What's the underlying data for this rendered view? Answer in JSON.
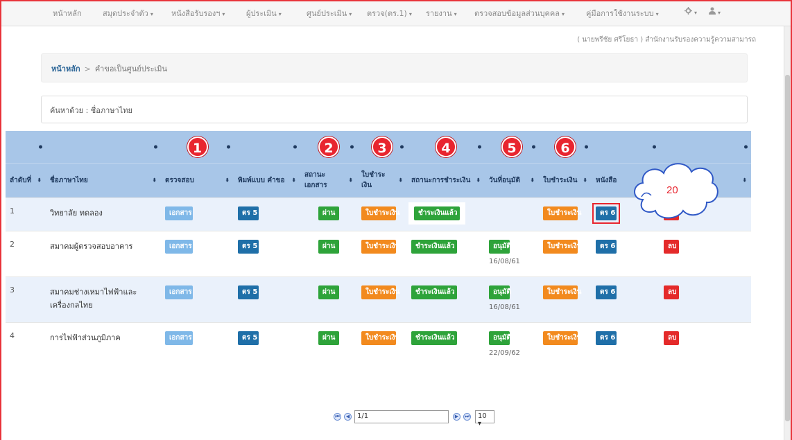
{
  "nav": {
    "items": [
      "หน้าหลัก",
      "สมุดประจำตัว",
      "หนังสือรับรองฯ",
      "ผู้ประเมิน",
      "ศูนย์ประเมิน",
      "ตรวจ(ตร.1)",
      "รายงาน",
      "ตรวจสอบข้อมูลส่วนบุคคล",
      "คู่มือการใช้งานระบบ"
    ],
    "caret": "▾",
    "settings_icon": "gear-icon",
    "user_icon": "user-icon"
  },
  "user_line": "( นายพรีชัย ศรีโยธา ) สำนักงานรับรองความรู้ความสามารถ",
  "breadcrumb": {
    "home": "หน้าหลัก",
    "separator": ">",
    "current": "คำขอเป็นศูนย์ประเมิน"
  },
  "search": {
    "label": "ค้นหาด้วย : ชื่อภาษาไทย"
  },
  "steps": [
    "1",
    "2",
    "3",
    "4",
    "5",
    "6"
  ],
  "headers": [
    "ลำดับที่",
    "ชื่อภาษาไทย",
    "ตรวจสอบ",
    "พิมพ์แบบ คำขอ",
    "สถานะเอกสาร",
    "ใบชำระเงิน",
    "สถานะการชำระเงิน",
    "วันที่อนุมัติ",
    "ใบชำระเงิน",
    "หนังสือ",
    ""
  ],
  "sort_symbol": "⬍",
  "buttons": {
    "doc": "เอกสาร",
    "form": "ตร 5",
    "pass": "ผ่าน",
    "invoice": "ใบชำระเงิน",
    "paid": "ชำระเงินแล้ว",
    "approve": "อนุมัติ",
    "cert": "ตร 6",
    "delete": "ลบ"
  },
  "rows": [
    {
      "no": "1",
      "name": "วิทยาลัย ทดลอง",
      "approve_date": ""
    },
    {
      "no": "2",
      "name": "สมาคมผู้ตรวจสอบอาคาร",
      "approve_date": "16/08/61"
    },
    {
      "no": "3",
      "name": "สมาคมช่างเหมาไฟฟ้าและเครื่องกลไทย",
      "approve_date": "16/08/61"
    },
    {
      "no": "4",
      "name": "การไฟฟ้าส่วนภูมิภาค",
      "approve_date": "22/09/62"
    }
  ],
  "callout": "20",
  "pager": {
    "first": "⏮",
    "prev": "◀",
    "page_value": "1/1",
    "next": "▶",
    "last": "⏭",
    "page_size": "10 ▾"
  },
  "colors": {
    "header_bg": "#a8c6e8",
    "step_badge": "#e8252f",
    "highlight": "#e8252f"
  }
}
